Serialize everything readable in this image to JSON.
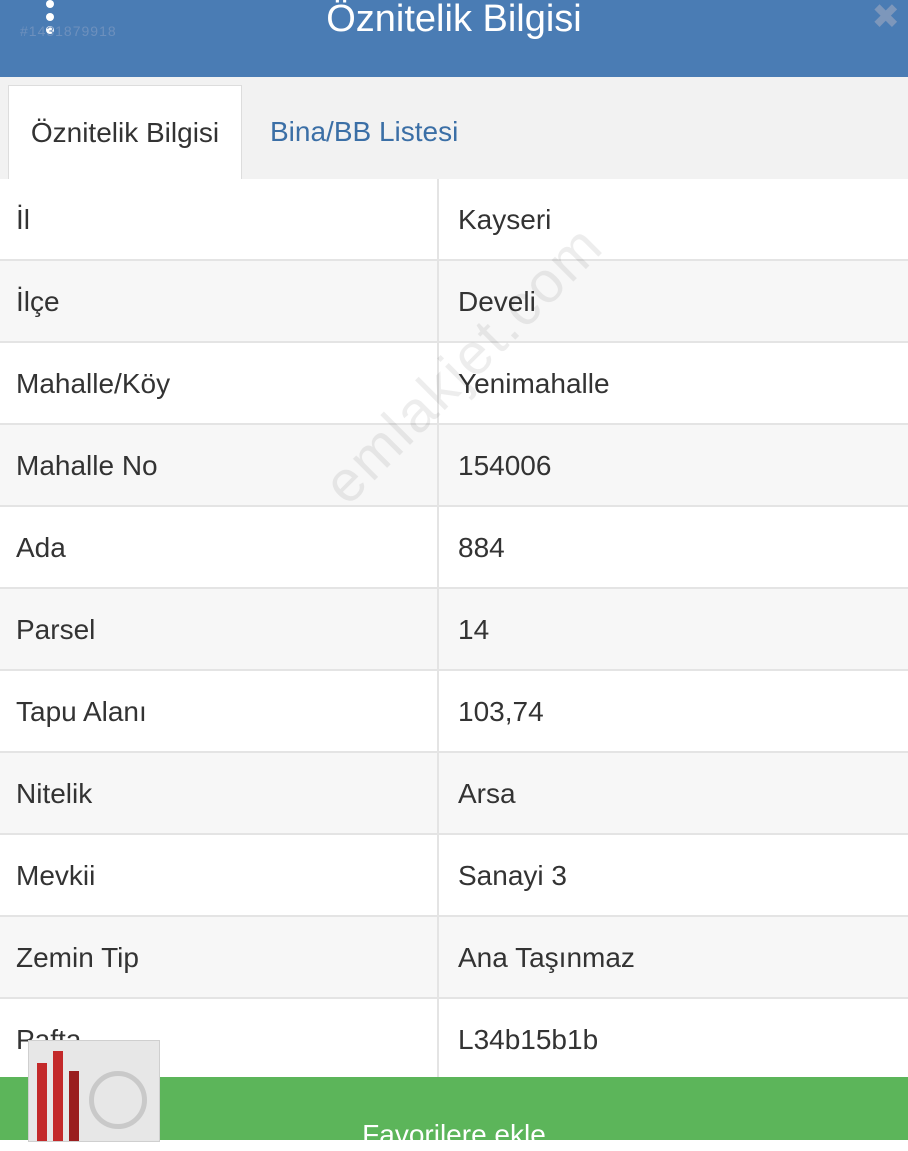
{
  "header": {
    "title": "Öznitelik Bilgisi",
    "id_text": "#1431879918",
    "menu_icon": "vertical-dots-icon",
    "close_icon": "close-icon",
    "background_color": "#4a7cb4"
  },
  "tabs": [
    {
      "label": "Öznitelik Bilgisi",
      "active": true
    },
    {
      "label": "Bina/BB Listesi",
      "active": false
    }
  ],
  "rows": [
    {
      "key": "İl",
      "value": "Kayseri"
    },
    {
      "key": "İlçe",
      "value": "Develi"
    },
    {
      "key": "Mahalle/Köy",
      "value": "Yenimahalle"
    },
    {
      "key": "Mahalle No",
      "value": "154006"
    },
    {
      "key": "Ada",
      "value": "884"
    },
    {
      "key": "Parsel",
      "value": "14"
    },
    {
      "key": "Tapu Alanı",
      "value": "103,74"
    },
    {
      "key": "Nitelik",
      "value": "Arsa"
    },
    {
      "key": "Mevkii",
      "value": "Sanayi 3"
    },
    {
      "key": "Zemin Tip",
      "value": "Ana Taşınmaz"
    },
    {
      "key": "Pafta",
      "value": "L34b15b1b"
    }
  ],
  "footer": {
    "button_label": "Favorilere ekle",
    "background_color": "#5cb55a"
  },
  "watermark": "emlakjet.com"
}
